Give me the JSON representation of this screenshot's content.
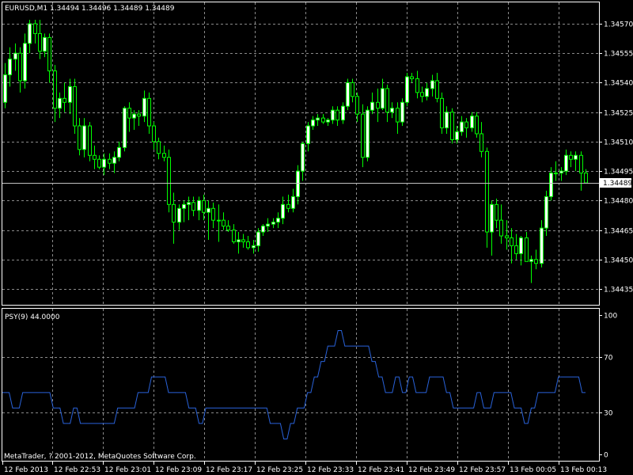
{
  "main_panel": {
    "info_label": "EURUSD,M1  1.34494 1.34496 1.34489 1.34489",
    "current_price_label": "1.34489"
  },
  "indicator_panel": {
    "label": "PSY(9) 44.0000"
  },
  "footer": {
    "copyright": "MetaTrader, ? 2001-2012, MetaQuotes Software Corp."
  },
  "colors": {
    "background": "#000000",
    "grid": "#8a8a8a",
    "axis": "#ffffff",
    "bull_fill": "#ffffff",
    "bear_fill": "#000000",
    "wick": "#00ff00",
    "indicator_line": "#2962d9",
    "current_price_line": "#c0c0c0"
  },
  "chart_data": [
    {
      "type": "candlestick",
      "title": "EURUSD,M1",
      "symbol": "EURUSD",
      "timeframe": "M1",
      "ohlc_header": {
        "open": 1.34494,
        "high": 1.34496,
        "low": 1.34489,
        "close": 1.34489
      },
      "current_price": 1.34489,
      "ylim": [
        1.3443,
        1.34575
      ],
      "y_ticks": [
        "1.34570",
        "1.34555",
        "1.34540",
        "1.34525",
        "1.34510",
        "1.34495",
        "1.34480",
        "1.34465",
        "1.34450",
        "1.34435"
      ],
      "x_ticks": [
        "12 Feb 2013",
        "12 Feb 22:53",
        "12 Feb 23:01",
        "12 Feb 23:09",
        "12 Feb 23:17",
        "12 Feb 23:25",
        "12 Feb 23:33",
        "12 Feb 23:41",
        "12 Feb 23:49",
        "12 Feb 23:57",
        "13 Feb 00:05",
        "13 Feb 00:13"
      ],
      "grid": true,
      "candles": [
        [
          1.3453,
          1.3455,
          1.34527,
          1.34544
        ],
        [
          1.34544,
          1.34558,
          1.34538,
          1.34552
        ],
        [
          1.34552,
          1.3456,
          1.34546,
          1.34555
        ],
        [
          1.34555,
          1.34558,
          1.34535,
          1.34541
        ],
        [
          1.34541,
          1.34565,
          1.34537,
          1.3456
        ],
        [
          1.3456,
          1.34572,
          1.34555,
          1.3457
        ],
        [
          1.3457,
          1.34572,
          1.3456,
          1.34565
        ],
        [
          1.34565,
          1.34572,
          1.34552,
          1.34556
        ],
        [
          1.34556,
          1.34565,
          1.34553,
          1.34563
        ],
        [
          1.34563,
          1.34565,
          1.3454,
          1.34546
        ],
        [
          1.34546,
          1.34549,
          1.3452,
          1.34527
        ],
        [
          1.34527,
          1.34535,
          1.34522,
          1.34532
        ],
        [
          1.34532,
          1.3454,
          1.34525,
          1.3453
        ],
        [
          1.3453,
          1.34542,
          1.34524,
          1.34538
        ],
        [
          1.34538,
          1.34542,
          1.34514,
          1.34518
        ],
        [
          1.34518,
          1.34522,
          1.34503,
          1.34506
        ],
        [
          1.34506,
          1.34522,
          1.34502,
          1.34518
        ],
        [
          1.34518,
          1.3452,
          1.345,
          1.34503
        ],
        [
          1.34503,
          1.34508,
          1.34496,
          1.34501
        ],
        [
          1.34501,
          1.34503,
          1.34496,
          1.34497
        ],
        [
          1.34497,
          1.34504,
          1.34493,
          1.34501
        ],
        [
          1.34501,
          1.34504,
          1.34496,
          1.34499
        ],
        [
          1.34499,
          1.34505,
          1.34494,
          1.34502
        ],
        [
          1.34502,
          1.3451,
          1.345,
          1.34507
        ],
        [
          1.34507,
          1.34528,
          1.34505,
          1.34527
        ],
        [
          1.34527,
          1.3453,
          1.34515,
          1.34522
        ],
        [
          1.34522,
          1.34526,
          1.34516,
          1.34524
        ],
        [
          1.34524,
          1.34526,
          1.34518,
          1.34523
        ],
        [
          1.34523,
          1.34536,
          1.3452,
          1.34532
        ],
        [
          1.34532,
          1.34535,
          1.34514,
          1.34518
        ],
        [
          1.34518,
          1.3452,
          1.34506,
          1.3451
        ],
        [
          1.3451,
          1.34512,
          1.34501,
          1.34504
        ],
        [
          1.34504,
          1.34508,
          1.345,
          1.34502
        ],
        [
          1.34502,
          1.34506,
          1.34474,
          1.34478
        ],
        [
          1.34478,
          1.34484,
          1.34458,
          1.34469
        ],
        [
          1.34469,
          1.34478,
          1.34465,
          1.34476
        ],
        [
          1.34476,
          1.3448,
          1.34469,
          1.34478
        ],
        [
          1.34478,
          1.34482,
          1.3447,
          1.34479
        ],
        [
          1.34479,
          1.34482,
          1.34472,
          1.34475
        ],
        [
          1.34475,
          1.34482,
          1.3447,
          1.3448
        ],
        [
          1.3448,
          1.34483,
          1.3447,
          1.34474
        ],
        [
          1.34474,
          1.3448,
          1.3446,
          1.34476
        ],
        [
          1.34476,
          1.34479,
          1.34466,
          1.3447
        ],
        [
          1.3447,
          1.34478,
          1.34459,
          1.3447
        ],
        [
          1.3447,
          1.34474,
          1.34465,
          1.34467
        ],
        [
          1.34467,
          1.3447,
          1.34464,
          1.34465
        ],
        [
          1.34465,
          1.34468,
          1.34458,
          1.34459
        ],
        [
          1.34459,
          1.34464,
          1.34453,
          1.3446
        ],
        [
          1.3446,
          1.34463,
          1.34456,
          1.34459
        ],
        [
          1.34459,
          1.34462,
          1.34455,
          1.34456
        ],
        [
          1.34456,
          1.3446,
          1.34453,
          1.34457
        ],
        [
          1.34457,
          1.34466,
          1.34454,
          1.34464
        ],
        [
          1.34464,
          1.34468,
          1.34462,
          1.34467
        ],
        [
          1.34467,
          1.34471,
          1.34464,
          1.34468
        ],
        [
          1.34468,
          1.34471,
          1.34466,
          1.34469
        ],
        [
          1.34469,
          1.34474,
          1.34466,
          1.34471
        ],
        [
          1.34471,
          1.34482,
          1.34468,
          1.34478
        ],
        [
          1.34478,
          1.34483,
          1.34474,
          1.34476
        ],
        [
          1.34476,
          1.34486,
          1.34474,
          1.34482
        ],
        [
          1.34482,
          1.34498,
          1.34478,
          1.34495
        ],
        [
          1.34495,
          1.3451,
          1.3449,
          1.34509
        ],
        [
          1.34509,
          1.3452,
          1.34505,
          1.34518
        ],
        [
          1.34518,
          1.34523,
          1.34516,
          1.34521
        ],
        [
          1.34521,
          1.34524,
          1.34518,
          1.34522
        ],
        [
          1.34522,
          1.34524,
          1.34519,
          1.3452
        ],
        [
          1.3452,
          1.34522,
          1.34518,
          1.34521
        ],
        [
          1.34521,
          1.34528,
          1.34519,
          1.34526
        ],
        [
          1.34526,
          1.34528,
          1.34518,
          1.34521
        ],
        [
          1.34521,
          1.3453,
          1.34519,
          1.34528
        ],
        [
          1.34528,
          1.34542,
          1.34526,
          1.3454
        ],
        [
          1.3454,
          1.34542,
          1.3453,
          1.34533
        ],
        [
          1.34533,
          1.34535,
          1.3452,
          1.34524
        ],
        [
          1.34524,
          1.34529,
          1.34497,
          1.34502
        ],
        [
          1.34502,
          1.34528,
          1.345,
          1.34526
        ],
        [
          1.34526,
          1.34535,
          1.34524,
          1.3453
        ],
        [
          1.3453,
          1.34537,
          1.3452,
          1.34527
        ],
        [
          1.34527,
          1.34542,
          1.34526,
          1.34537
        ],
        [
          1.34537,
          1.34539,
          1.3452,
          1.34525
        ],
        [
          1.34525,
          1.3453,
          1.34522,
          1.34527
        ],
        [
          1.34527,
          1.3453,
          1.34514,
          1.3452
        ],
        [
          1.3452,
          1.34532,
          1.34518,
          1.3453
        ],
        [
          1.3453,
          1.34545,
          1.34528,
          1.34543
        ],
        [
          1.34543,
          1.34545,
          1.3454,
          1.34542
        ],
        [
          1.34542,
          1.34546,
          1.34532,
          1.34535
        ],
        [
          1.34535,
          1.34538,
          1.3453,
          1.34533
        ],
        [
          1.34533,
          1.3454,
          1.34531,
          1.34537
        ],
        [
          1.34537,
          1.34544,
          1.34533,
          1.34541
        ],
        [
          1.34541,
          1.34545,
          1.3453,
          1.34532
        ],
        [
          1.34532,
          1.34535,
          1.34514,
          1.34517
        ],
        [
          1.34517,
          1.34528,
          1.34514,
          1.34525
        ],
        [
          1.34525,
          1.34527,
          1.34509,
          1.34511
        ],
        [
          1.34511,
          1.34518,
          1.34509,
          1.34515
        ],
        [
          1.34515,
          1.34523,
          1.34513,
          1.3452
        ],
        [
          1.3452,
          1.34522,
          1.34512,
          1.34517
        ],
        [
          1.34517,
          1.34525,
          1.34515,
          1.34523
        ],
        [
          1.34523,
          1.34525,
          1.34512,
          1.34514
        ],
        [
          1.34514,
          1.3452,
          1.34502,
          1.34505
        ],
        [
          1.34505,
          1.34507,
          1.34456,
          1.34464
        ],
        [
          1.34464,
          1.3448,
          1.34452,
          1.34478
        ],
        [
          1.34478,
          1.34481,
          1.34466,
          1.3447
        ],
        [
          1.3447,
          1.34478,
          1.34458,
          1.34462
        ],
        [
          1.34462,
          1.3447,
          1.34455,
          1.34461
        ],
        [
          1.34461,
          1.34466,
          1.34448,
          1.34457
        ],
        [
          1.34457,
          1.34463,
          1.3445,
          1.34453
        ],
        [
          1.34453,
          1.34462,
          1.34447,
          1.34461
        ],
        [
          1.34461,
          1.34464,
          1.34449,
          1.34449
        ],
        [
          1.34449,
          1.34452,
          1.34438,
          1.3445
        ],
        [
          1.3445,
          1.34455,
          1.34445,
          1.34448
        ],
        [
          1.34448,
          1.3447,
          1.34446,
          1.34466
        ],
        [
          1.34466,
          1.34485,
          1.34462,
          1.34482
        ],
        [
          1.34482,
          1.34497,
          1.3448,
          1.34494
        ],
        [
          1.34494,
          1.345,
          1.3449,
          1.34494
        ],
        [
          1.34494,
          1.34497,
          1.3449,
          1.34495
        ],
        [
          1.34495,
          1.34506,
          1.34493,
          1.34503
        ],
        [
          1.34503,
          1.34505,
          1.34497,
          1.34501
        ],
        [
          1.34501,
          1.34505,
          1.34495,
          1.34503
        ],
        [
          1.34503,
          1.34505,
          1.34485,
          1.34494
        ],
        [
          1.34494,
          1.34496,
          1.34489,
          1.34489
        ]
      ]
    },
    {
      "type": "line",
      "title": "PSY(9) 44.0000",
      "ylim": [
        0,
        100
      ],
      "y_ticks": [
        "100",
        "70",
        "30",
        "0"
      ],
      "grid": true,
      "series": [
        {
          "name": "PSY(9)",
          "values": [
            44.4,
            44.4,
            44.4,
            33.3,
            33.3,
            33.3,
            44.4,
            44.4,
            44.4,
            44.4,
            44.4,
            44.4,
            44.4,
            44.4,
            44.4,
            33.3,
            33.3,
            33.3,
            22.2,
            22.2,
            22.2,
            33.3,
            33.3,
            22.2,
            22.2,
            22.2,
            22.2,
            22.2,
            22.2,
            22.2,
            22.2,
            22.2,
            22.2,
            22.2,
            33.3,
            33.3,
            33.3,
            33.3,
            33.3,
            33.3,
            44.4,
            44.4,
            44.4,
            44.4,
            55.6,
            55.6,
            55.6,
            55.6,
            55.6,
            44.4,
            44.4,
            44.4,
            44.4,
            44.4,
            44.4,
            33.3,
            33.3,
            33.3,
            22.2,
            22.2,
            33.3,
            33.3,
            33.3,
            33.3,
            33.3,
            33.3,
            33.3,
            33.3,
            33.3,
            33.3,
            33.3,
            33.3,
            33.3,
            33.3,
            33.3,
            33.3,
            33.3,
            33.3,
            33.3,
            22.2,
            22.2,
            22.2,
            22.2,
            11.1,
            11.1,
            22.2,
            22.2,
            33.3,
            33.3,
            33.3,
            44.4,
            44.4,
            55.6,
            55.6,
            66.7,
            66.7,
            77.8,
            77.8,
            77.8,
            88.9,
            88.9,
            77.8,
            77.8,
            77.8,
            77.8,
            77.8,
            77.8,
            77.8,
            77.8,
            66.7,
            66.7,
            55.6,
            55.6,
            44.4,
            44.4,
            44.4,
            55.6,
            55.6,
            44.4,
            44.4,
            55.6,
            55.6,
            44.4,
            44.4,
            44.4,
            44.4,
            55.6,
            55.6,
            55.6,
            55.6,
            55.6,
            44.4,
            44.4,
            33.3,
            33.3,
            33.3,
            33.3,
            33.3,
            33.3,
            33.3,
            44.4,
            44.4,
            33.3,
            33.3,
            33.3,
            44.4,
            44.4,
            44.4,
            44.4,
            44.4,
            44.4,
            33.3,
            33.3,
            33.3,
            22.2,
            22.2,
            33.3,
            33.3,
            44.4,
            44.4,
            44.4,
            44.4,
            44.4,
            44.4,
            55.6,
            55.6,
            55.6,
            55.6,
            55.6,
            55.6,
            55.6,
            44.4,
            44.4
          ]
        }
      ]
    }
  ]
}
